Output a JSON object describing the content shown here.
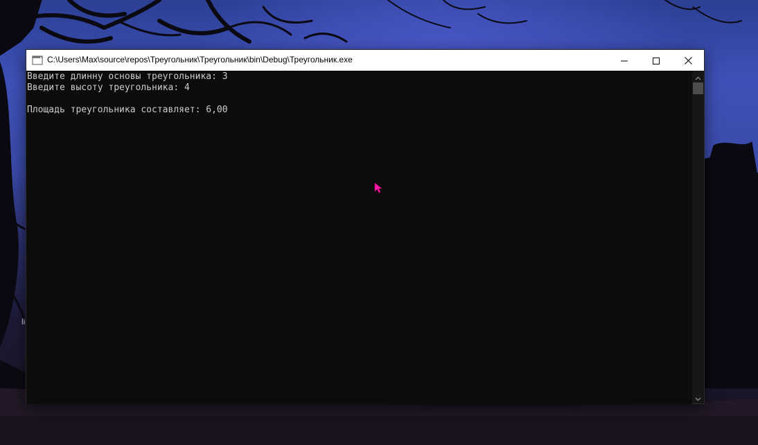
{
  "window": {
    "title": "C:\\Users\\Max\\source\\repos\\Треугольник\\Треугольник\\bin\\Debug\\Треугольник.exe",
    "icons": {
      "app": "console-app-icon",
      "minimize": "minimize-icon",
      "maximize": "maximize-icon",
      "close": "close-icon"
    }
  },
  "console": {
    "lines": [
      "Введите длинну основы треугольника: 3",
      "Введите высоту треугольника: 4",
      "",
      "Площадь треугольника составляет: 6,00"
    ],
    "text_color": "#cccccc",
    "background": "#0c0c0c"
  },
  "desktop": {
    "partial_label": "li"
  },
  "cursor": {
    "icon": "mouse-pointer-icon",
    "color": "#ff1aa8"
  }
}
